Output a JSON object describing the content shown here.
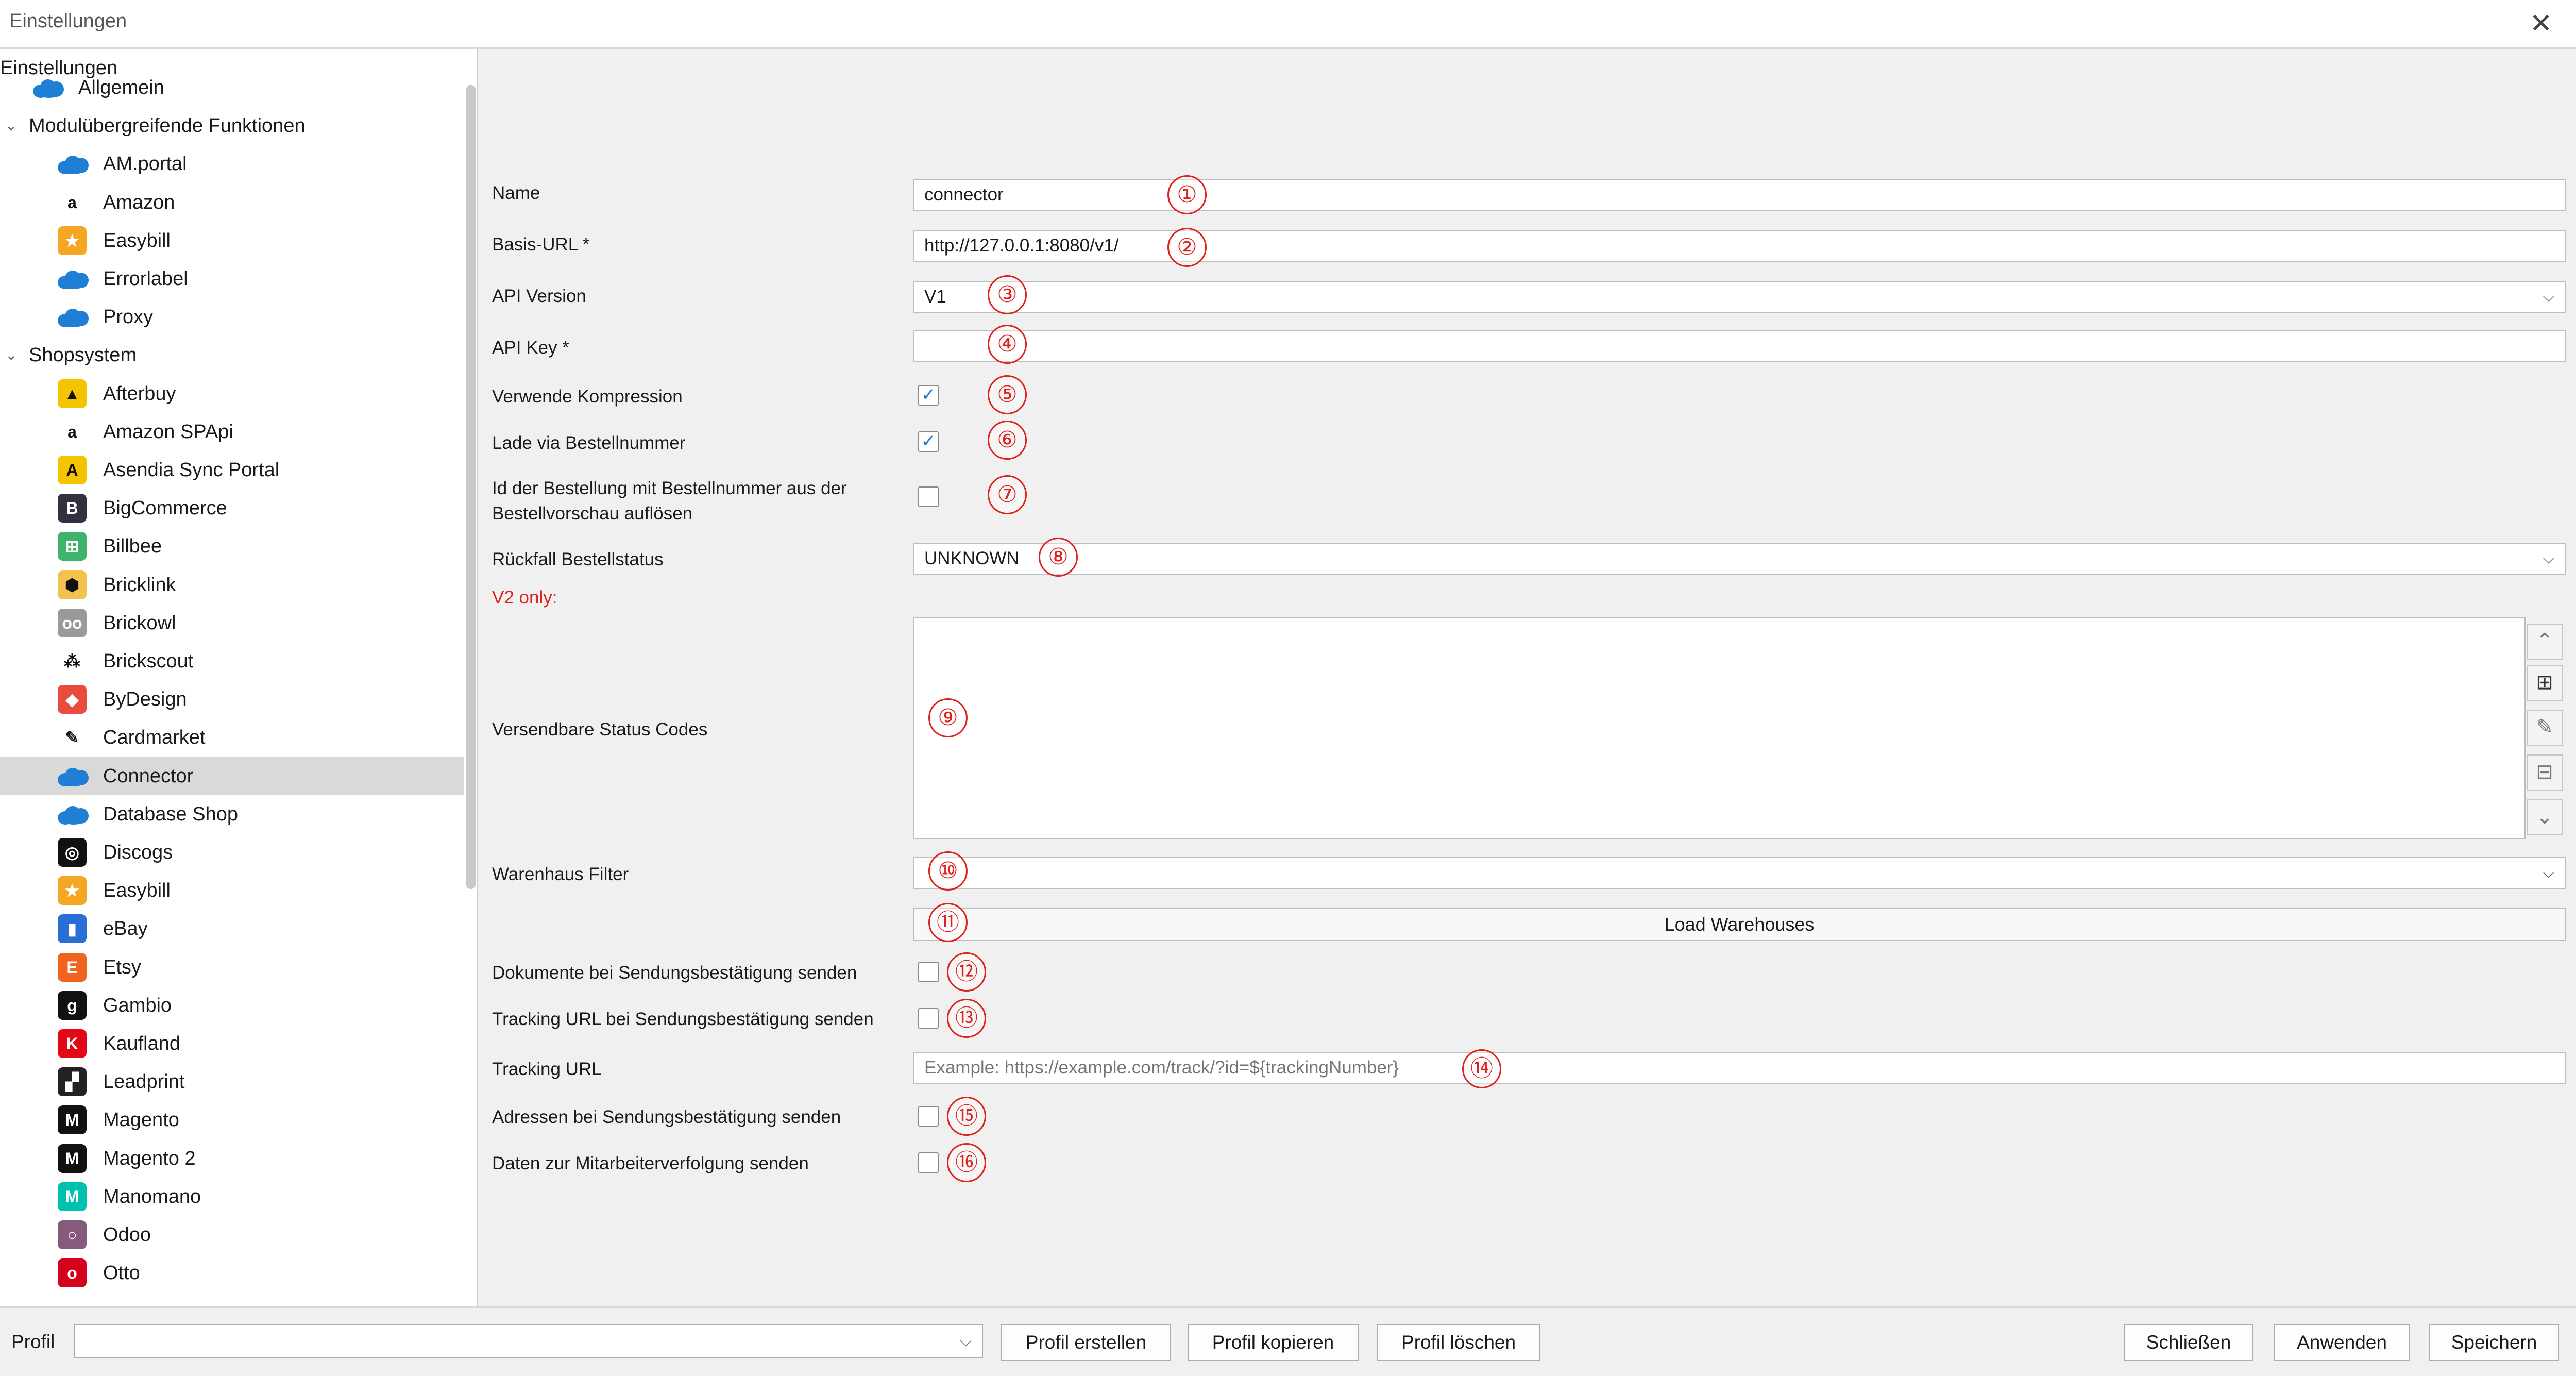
{
  "window": {
    "title": "Einstellungen",
    "close_symbol": "✕"
  },
  "sidebar": {
    "root_label": "Einstellungen",
    "items": [
      {
        "label": "Allgemein",
        "icon": "cloud-icon",
        "color": "#1f7fd4",
        "glyph": ""
      },
      {
        "label": "Modulübergreifende Funktionen",
        "group": true
      },
      {
        "label": "AM.portal",
        "icon": "cloud-icon",
        "color": "#1f7fd4",
        "glyph": ""
      },
      {
        "label": "Amazon",
        "icon": "amazon-icon",
        "color": "#ffffff",
        "glyph": "a"
      },
      {
        "label": "Easybill",
        "icon": "easybill-icon",
        "color": "#f5a623",
        "glyph": "★"
      },
      {
        "label": "Errorlabel",
        "icon": "cloud-icon",
        "color": "#1f7fd4",
        "glyph": ""
      },
      {
        "label": "Proxy",
        "icon": "cloud-icon",
        "color": "#1f7fd4",
        "glyph": ""
      },
      {
        "label": "Shopsystem",
        "group": true
      },
      {
        "label": "Afterbuy",
        "icon": "afterbuy-icon",
        "color": "#f4c400",
        "glyph": "▲"
      },
      {
        "label": "Amazon SPApi",
        "icon": "amazon-icon",
        "color": "#ffffff",
        "glyph": "a"
      },
      {
        "label": "Asendia Sync Portal",
        "icon": "asendia-icon",
        "color": "#f4c400",
        "glyph": "A"
      },
      {
        "label": "BigCommerce",
        "icon": "bigcommerce-icon",
        "color": "#34313f",
        "glyph": "B"
      },
      {
        "label": "Billbee",
        "icon": "billbee-icon",
        "color": "#3fb36b",
        "glyph": "⊞"
      },
      {
        "label": "Bricklink",
        "icon": "bricklink-icon",
        "color": "#f2c14e",
        "glyph": "⬢"
      },
      {
        "label": "Brickowl",
        "icon": "brickowl-icon",
        "color": "#9a9a9a",
        "glyph": "oo"
      },
      {
        "label": "Brickscout",
        "icon": "brickscout-icon",
        "color": "#ffffff",
        "glyph": "⁂"
      },
      {
        "label": "ByDesign",
        "icon": "bydesign-icon",
        "color": "#e94b3c",
        "glyph": "◆"
      },
      {
        "label": "Cardmarket",
        "icon": "cardmarket-icon",
        "color": "#ffffff",
        "glyph": "✎"
      },
      {
        "label": "Connector",
        "icon": "cloud-icon",
        "color": "#1f7fd4",
        "glyph": "",
        "selected": true
      },
      {
        "label": "Database Shop",
        "icon": "cloud-icon",
        "color": "#1f7fd4",
        "glyph": ""
      },
      {
        "label": "Discogs",
        "icon": "discogs-icon",
        "color": "#111111",
        "glyph": "◎"
      },
      {
        "label": "Easybill",
        "icon": "easybill-icon",
        "color": "#f5a623",
        "glyph": "★"
      },
      {
        "label": "eBay",
        "icon": "ebay-icon",
        "color": "#2a6fd6",
        "glyph": "▮"
      },
      {
        "label": "Etsy",
        "icon": "etsy-icon",
        "color": "#f1641e",
        "glyph": "E"
      },
      {
        "label": "Gambio",
        "icon": "gambio-icon",
        "color": "#111111",
        "glyph": "g"
      },
      {
        "label": "Kaufland",
        "icon": "kaufland-icon",
        "color": "#e10915",
        "glyph": "K"
      },
      {
        "label": "Leadprint",
        "icon": "leadprint-icon",
        "color": "#222222",
        "glyph": "▞"
      },
      {
        "label": "Magento",
        "icon": "magento-icon",
        "color": "#111111",
        "glyph": "M"
      },
      {
        "label": "Magento 2",
        "icon": "magento-icon",
        "color": "#111111",
        "glyph": "M"
      },
      {
        "label": "Manomano",
        "icon": "manomano-icon",
        "color": "#00c1b0",
        "glyph": "M"
      },
      {
        "label": "Odoo",
        "icon": "odoo-icon",
        "color": "#875a7b",
        "glyph": "○"
      },
      {
        "label": "Otto",
        "icon": "otto-icon",
        "color": "#d4021d",
        "glyph": "o"
      }
    ]
  },
  "form": {
    "name": {
      "label": "Name",
      "value": "connector",
      "marker": "①"
    },
    "base_url": {
      "label": "Basis-URL *",
      "value": "http://127.0.0.1:8080/v1/",
      "marker": "②"
    },
    "api_version": {
      "label": "API Version",
      "value": "V1",
      "marker": "③"
    },
    "api_key": {
      "label": "API Key *",
      "value": "",
      "marker": "④"
    },
    "compression": {
      "label": "Verwende Kompression",
      "checked": true,
      "marker": "⑤"
    },
    "load_by_order_number": {
      "label": "Lade via Bestellnummer",
      "checked": true,
      "marker": "⑥"
    },
    "resolve_order_id": {
      "label_line1": "Id der Bestellung mit Bestellnummer aus der",
      "label_line2": "Bestellvorschau auflösen",
      "checked": false,
      "marker": "⑦"
    },
    "fallback_status": {
      "label": "Rückfall Bestellstatus",
      "value": "UNKNOWN",
      "marker": "⑧"
    },
    "v2_note": "V2 only:",
    "status_codes": {
      "label": "Versendbare Status Codes",
      "marker": "⑨"
    },
    "warehouse_filter": {
      "label": "Warenhaus Filter",
      "value": "",
      "marker": "⑩"
    },
    "load_warehouses": {
      "label": "Load Warehouses",
      "marker": "⑪"
    },
    "send_documents": {
      "label": "Dokumente bei Sendungsbestätigung senden",
      "checked": false,
      "marker": "⑫"
    },
    "send_tracking_url": {
      "label": "Tracking URL bei Sendungsbestätigung senden",
      "checked": false,
      "marker": "⑬"
    },
    "tracking_url": {
      "label": "Tracking URL",
      "placeholder": "Example: https://example.com/track/?id=${trackingNumber}",
      "marker": "⑭"
    },
    "send_addresses": {
      "label": "Adressen bei Sendungsbestätigung senden",
      "checked": false,
      "marker": "⑮"
    },
    "employee_tracking": {
      "label": "Daten zur Mitarbeiterverfolgung senden",
      "checked": false,
      "marker": "⑯"
    }
  },
  "bottom": {
    "profile_label": "Profil",
    "profile_value": "",
    "create_profile": "Profil erstellen",
    "copy_profile": "Profil kopieren",
    "delete_profile": "Profil löschen",
    "close": "Schließen",
    "apply": "Anwenden",
    "save": "Speichern"
  },
  "colors": {
    "marker_red": "#e0201b",
    "checkbox_blue": "#1f6fd0",
    "v2_red": "#e0201b",
    "selected_row": "#d9d9d9"
  }
}
